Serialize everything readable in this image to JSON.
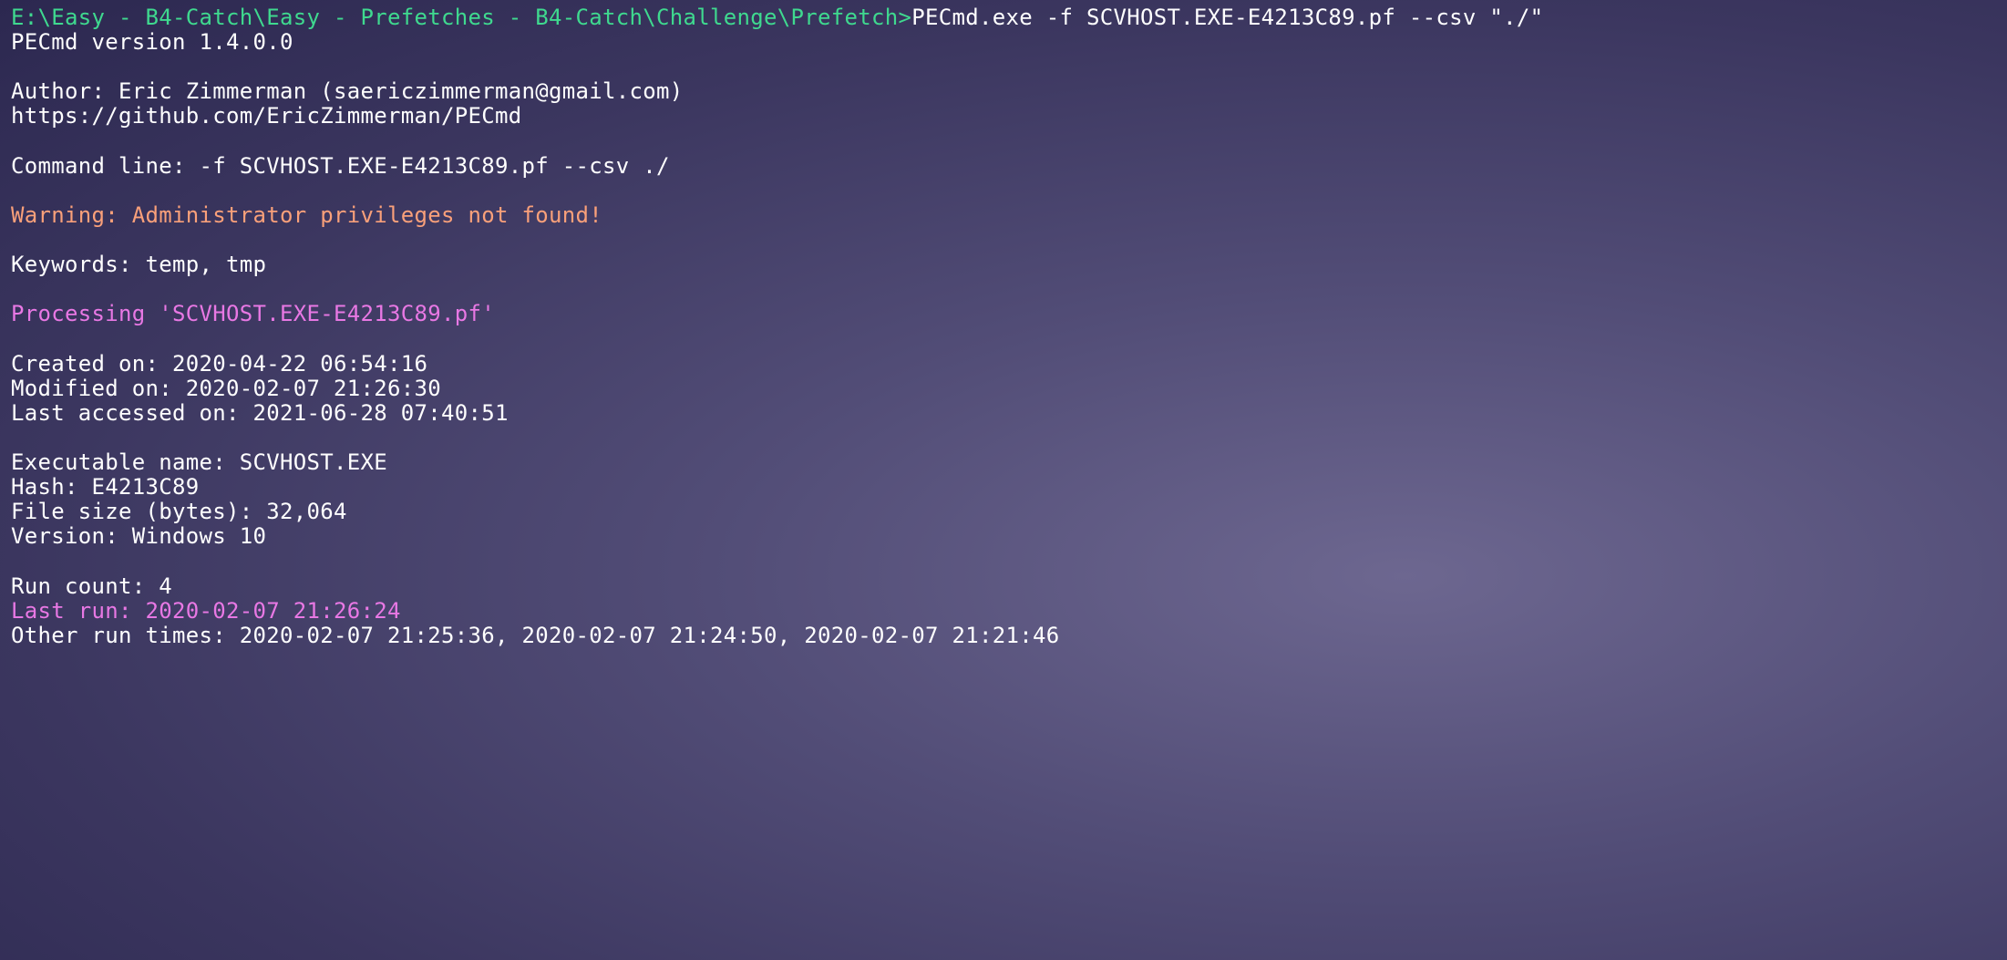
{
  "prompt": "E:\\Easy - B4-Catch\\Easy - Prefetches - B4-Catch\\Challenge\\Prefetch>",
  "command": "PECmd.exe -f SCVHOST.EXE-E4213C89.pf --csv \"./\"",
  "version_line": "PECmd version 1.4.0.0",
  "author_line": "Author: Eric Zimmerman (saericzimmerman@gmail.com)",
  "github_line": "https://github.com/EricZimmerman/PECmd",
  "cmdline_line": "Command line: -f SCVHOST.EXE-E4213C89.pf --csv ./",
  "warning_line": "Warning: Administrator privileges not found!",
  "keywords_line": "Keywords: temp, tmp",
  "processing_line": "Processing 'SCVHOST.EXE-E4213C89.pf'",
  "created_line": "Created on: 2020-04-22 06:54:16",
  "modified_line": "Modified on: 2020-02-07 21:26:30",
  "accessed_line": "Last accessed on: 2021-06-28 07:40:51",
  "exe_name_line": "Executable name: SCVHOST.EXE",
  "hash_line": "Hash: E4213C89",
  "filesize_line": "File size (bytes): 32,064",
  "version_os_line": "Version: Windows 10",
  "runcount_line": "Run count: 4",
  "lastrun_line": "Last run: 2020-02-07 21:26:24",
  "otherruns_line": "Other run times: 2020-02-07 21:25:36, 2020-02-07 21:24:50, 2020-02-07 21:21:46"
}
